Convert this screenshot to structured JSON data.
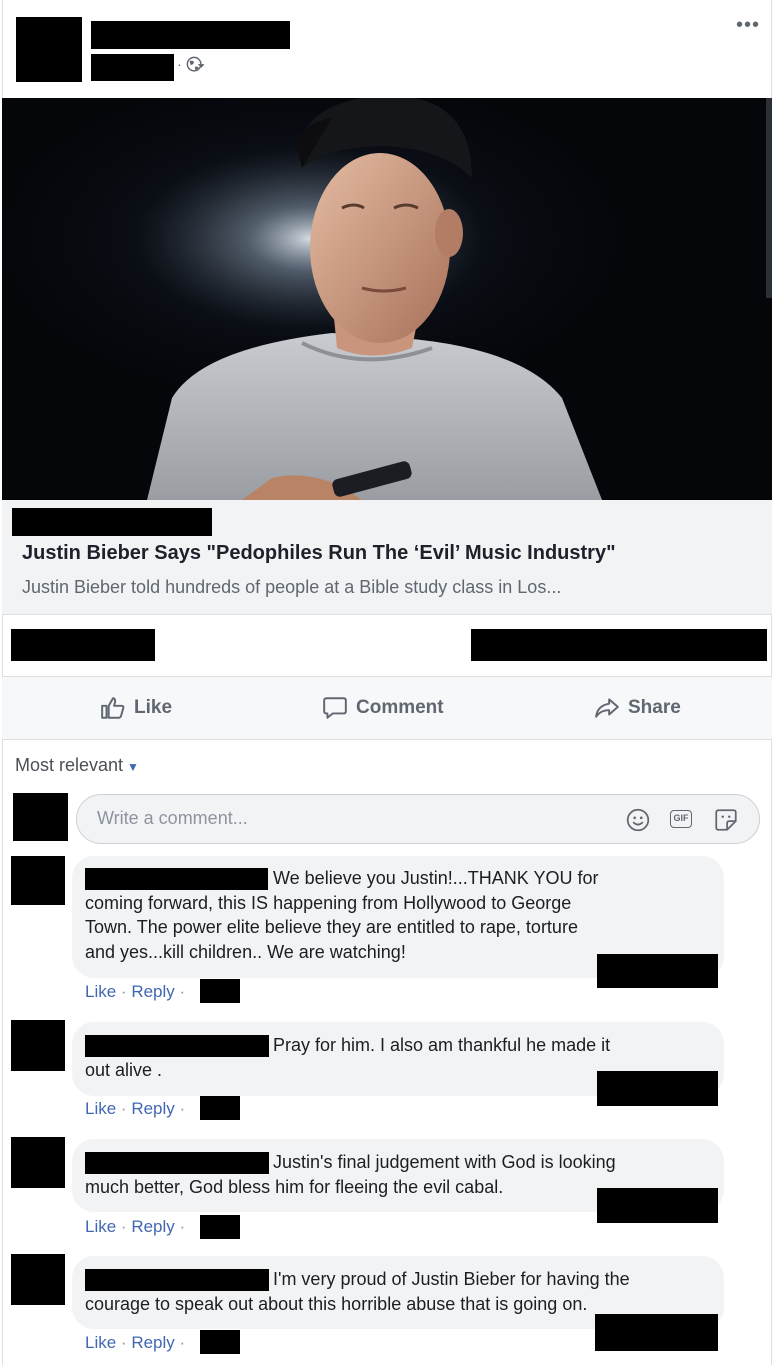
{
  "post": {
    "more_label": "•••",
    "link_title": "Justin Bieber Says \"Pedophiles Run The ‘Evil’ Music Industry\"",
    "link_description": "Justin Bieber told hundreds of people at a Bible study class in Los..."
  },
  "actions": {
    "like": "Like",
    "comment": "Comment",
    "share": "Share"
  },
  "comments_section": {
    "sort_label": "Most relevant",
    "compose_placeholder": "Write a comment...",
    "compose_icons": [
      "smiley-icon",
      "gif-icon",
      "sticker-icon"
    ],
    "gif_label": "GIF"
  },
  "comments": [
    {
      "lines": [
        "We believe you Justin!...THANK YOU for",
        "coming forward, this IS happening from Hollywood to George",
        "Town. The power elite believe they are entitled to rape, torture",
        "and yes...kill children.. We are watching!"
      ],
      "like": "Like",
      "reply": "Reply",
      "sep": "·"
    },
    {
      "lines": [
        "Pray for him. I also am thankful he made it",
        "out alive ."
      ],
      "like": "Like",
      "reply": "Reply",
      "sep": "·"
    },
    {
      "lines": [
        "Justin's final judgement with God is looking",
        "much better, God bless him for fleeing the evil cabal."
      ],
      "like": "Like",
      "reply": "Reply",
      "sep": "·"
    },
    {
      "lines": [
        "I'm very proud of Justin Bieber for having the",
        "courage to speak out about this horrible abuse that is going on."
      ],
      "like": "Like",
      "reply": "Reply",
      "sep": "·"
    }
  ],
  "colors": {
    "link_blue": "#4267b2",
    "bubble_bg": "#f2f3f5",
    "secondary_text": "#606770"
  }
}
